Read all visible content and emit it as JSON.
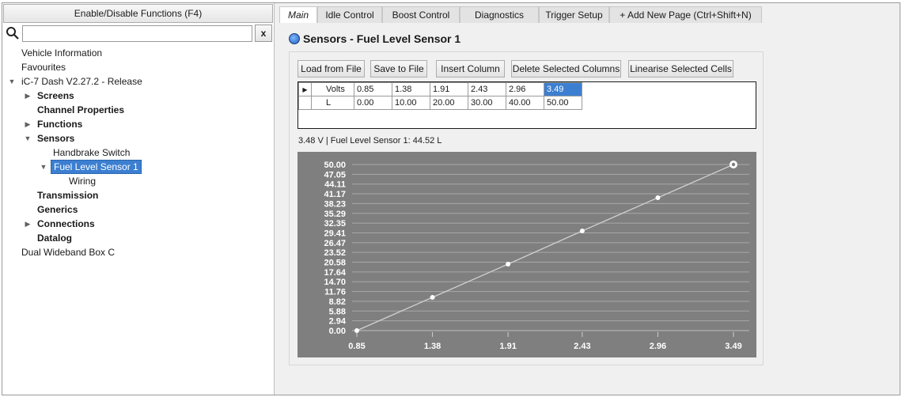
{
  "left": {
    "enable_label": "Enable/Disable Functions (F4)",
    "search_value": "",
    "clear_label": "x",
    "tree": [
      {
        "label": "Vehicle Information",
        "indent": 0,
        "bold": false,
        "arrow": "none"
      },
      {
        "label": "Favourites",
        "indent": 0,
        "bold": false,
        "arrow": "none"
      },
      {
        "label": "iC-7 Dash V2.27.2 - Release",
        "indent": 0,
        "bold": false,
        "arrow": "down"
      },
      {
        "label": "Screens",
        "indent": 1,
        "bold": true,
        "arrow": "right"
      },
      {
        "label": "Channel Properties",
        "indent": 1,
        "bold": true,
        "arrow": "none"
      },
      {
        "label": "Functions",
        "indent": 1,
        "bold": true,
        "arrow": "right"
      },
      {
        "label": "Sensors",
        "indent": 1,
        "bold": true,
        "arrow": "down"
      },
      {
        "label": "Handbrake Switch",
        "indent": 2,
        "bold": false,
        "arrow": "none"
      },
      {
        "label": "Fuel Level Sensor 1",
        "indent": 2,
        "bold": false,
        "arrow": "down",
        "selected": true
      },
      {
        "label": "Wiring",
        "indent": 3,
        "bold": false,
        "arrow": "none"
      },
      {
        "label": "Transmission",
        "indent": 1,
        "bold": true,
        "arrow": "none"
      },
      {
        "label": "Generics",
        "indent": 1,
        "bold": true,
        "arrow": "none"
      },
      {
        "label": "Connections",
        "indent": 1,
        "bold": true,
        "arrow": "right"
      },
      {
        "label": "Datalog",
        "indent": 1,
        "bold": true,
        "arrow": "none"
      },
      {
        "label": "Dual Wideband Box C",
        "indent": 0,
        "bold": false,
        "arrow": "none"
      }
    ]
  },
  "tabs": [
    {
      "label": "Main",
      "active": true
    },
    {
      "label": "Idle Control",
      "active": false
    },
    {
      "label": "Boost Control",
      "active": false
    },
    {
      "label": "Diagnostics",
      "active": false
    },
    {
      "label": "Trigger Setup",
      "active": false
    },
    {
      "label": "+ Add New Page (Ctrl+Shift+N)",
      "active": false
    }
  ],
  "page": {
    "title": "Sensors - Fuel Level Sensor 1",
    "buttons": [
      "Load from File",
      "Save to File",
      "Insert Column",
      "Delete Selected Columns",
      "Linearise Selected Cells"
    ],
    "table": {
      "rows": [
        {
          "label": "Volts",
          "values": [
            "0.85",
            "1.38",
            "1.91",
            "2.43",
            "2.96",
            "3.49"
          ],
          "arrow": true
        },
        {
          "label": "L",
          "values": [
            "0.00",
            "10.00",
            "20.00",
            "30.00",
            "40.00",
            "50.00"
          ],
          "arrow": false
        }
      ],
      "selected_cell": {
        "row": 0,
        "col": 5
      }
    },
    "readout": "3.48 V | Fuel Level Sensor 1: 44.52 L"
  },
  "colors": {
    "selection": "#3c7fd1",
    "chart_bg": "#7f7f7f",
    "chart_line": "#d0d0d0",
    "point": "#ffffff"
  },
  "chart_data": {
    "type": "line",
    "x": [
      0.85,
      1.38,
      1.91,
      2.43,
      2.96,
      3.49
    ],
    "x_ticks": [
      "0.85",
      "1.38",
      "1.91",
      "2.43",
      "2.96",
      "3.49"
    ],
    "y": [
      0.0,
      10.0,
      20.0,
      30.0,
      40.0,
      50.0
    ],
    "y_ticks": [
      "50.00",
      "47.05",
      "44.11",
      "41.17",
      "38.23",
      "35.29",
      "32.35",
      "29.41",
      "26.47",
      "23.52",
      "20.58",
      "17.64",
      "14.70",
      "11.76",
      "8.82",
      "5.88",
      "2.94",
      "0.00"
    ],
    "ylim": [
      0,
      50
    ],
    "xlim": [
      0.85,
      3.49
    ],
    "grid": true,
    "highlighted_point": 5
  }
}
